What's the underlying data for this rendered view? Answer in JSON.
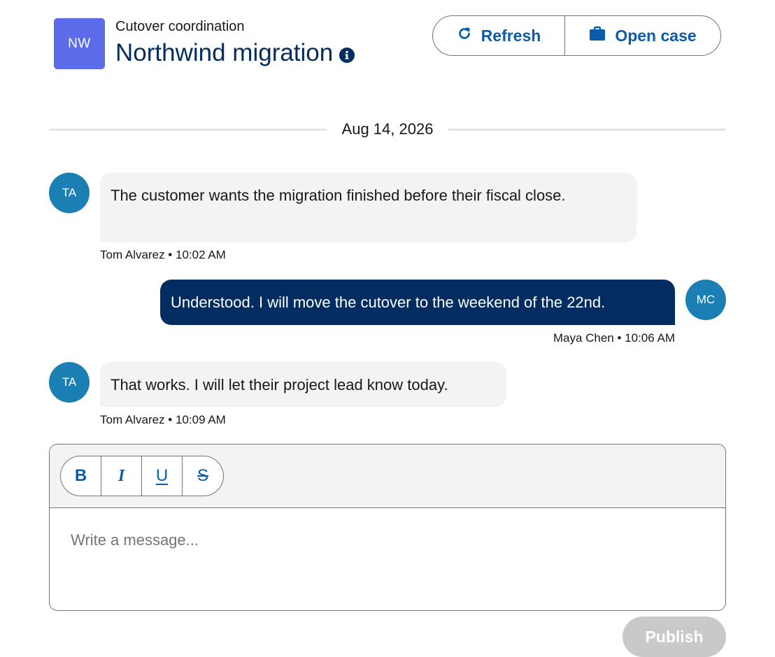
{
  "header": {
    "avatar_initials": "NW",
    "subtitle": "Cutover coordination",
    "title": "Northwind migration",
    "info_icon": "info-icon",
    "buttons": [
      {
        "label": "Refresh",
        "icon": "refresh-icon"
      },
      {
        "label": "Open case",
        "icon": "briefcase-icon"
      }
    ]
  },
  "conversation": {
    "date": "Aug 14, 2026",
    "messages": [
      {
        "direction": "inbound",
        "initials": "TA",
        "text": "The customer wants the migration finished before their fiscal close.",
        "author": "Tom Alvarez",
        "time": "10:02 AM",
        "meta": "Tom Alvarez • 10:02 AM"
      },
      {
        "direction": "outbound",
        "initials": "MC",
        "text": "Understood. I will move the cutover to the weekend of the 22nd.",
        "author": "Maya Chen",
        "time": "10:06 AM",
        "meta": "Maya Chen • 10:06 AM"
      },
      {
        "direction": "inbound",
        "initials": "TA",
        "text": "That works. I will let their project lead know today.",
        "author": "Tom Alvarez",
        "time": "10:09 AM",
        "meta": "Tom Alvarez • 10:09 AM"
      }
    ]
  },
  "composer": {
    "format_buttons": [
      {
        "label": "B",
        "name": "bold"
      },
      {
        "label": "I",
        "name": "italic"
      },
      {
        "label": "U",
        "name": "underline"
      },
      {
        "label": "S",
        "name": "strikethrough"
      }
    ],
    "placeholder": "Write a message...",
    "value": "",
    "publish_label": "Publish"
  },
  "colors": {
    "brand_navy": "#032d60",
    "link_blue": "#0b5cab",
    "avatar_blue": "#1b7fb3",
    "team_avatar": "#5b6bea",
    "disabled_button": "#c9c9c9"
  }
}
